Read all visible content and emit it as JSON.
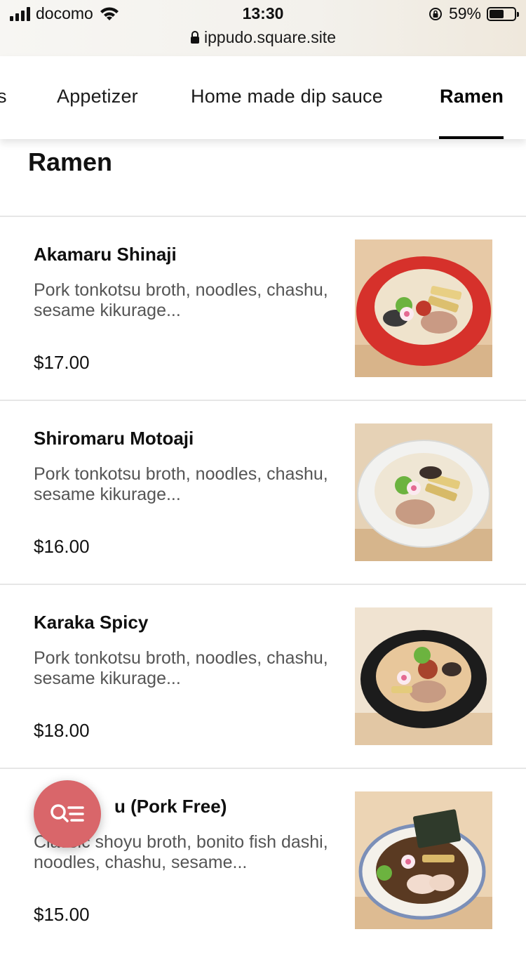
{
  "status_bar": {
    "carrier": "docomo",
    "time": "13:30",
    "url": "ippudo.square.site",
    "battery": "59%",
    "battery_level": 0.59
  },
  "tabs": [
    {
      "label": "s"
    },
    {
      "label": "Appetizer"
    },
    {
      "label": "Home made dip sauce"
    },
    {
      "label": "Ramen",
      "active": true
    }
  ],
  "section": {
    "title": "Ramen"
  },
  "items": [
    {
      "name": "Akamaru Shinaji",
      "description": "Pork tonkotsu broth, noodles, chashu, sesame kikurage...",
      "price": "$17.00",
      "bowl_color": "#d6312b"
    },
    {
      "name": "Shiromaru Motoaji",
      "description": "Pork tonkotsu broth, noodles, chashu, sesame kikurage...",
      "price": "$16.00",
      "bowl_color": "#f2f2f0"
    },
    {
      "name": "Karaka Spicy",
      "description": "Pork tonkotsu broth, noodles, chashu, sesame kikurage...",
      "price": "$18.00",
      "bowl_color": "#1c1c1c"
    },
    {
      "name": "u (Pork Free)",
      "description": "Classic shoyu broth, bonito fish dashi, noodles, chashu, sesame...",
      "price": "$15.00",
      "bowl_color": "#f4f1ea"
    }
  ],
  "colors": {
    "fab": "#d9666a",
    "accent": "#000000"
  },
  "icons": {
    "fab": "search-filter-icon"
  }
}
